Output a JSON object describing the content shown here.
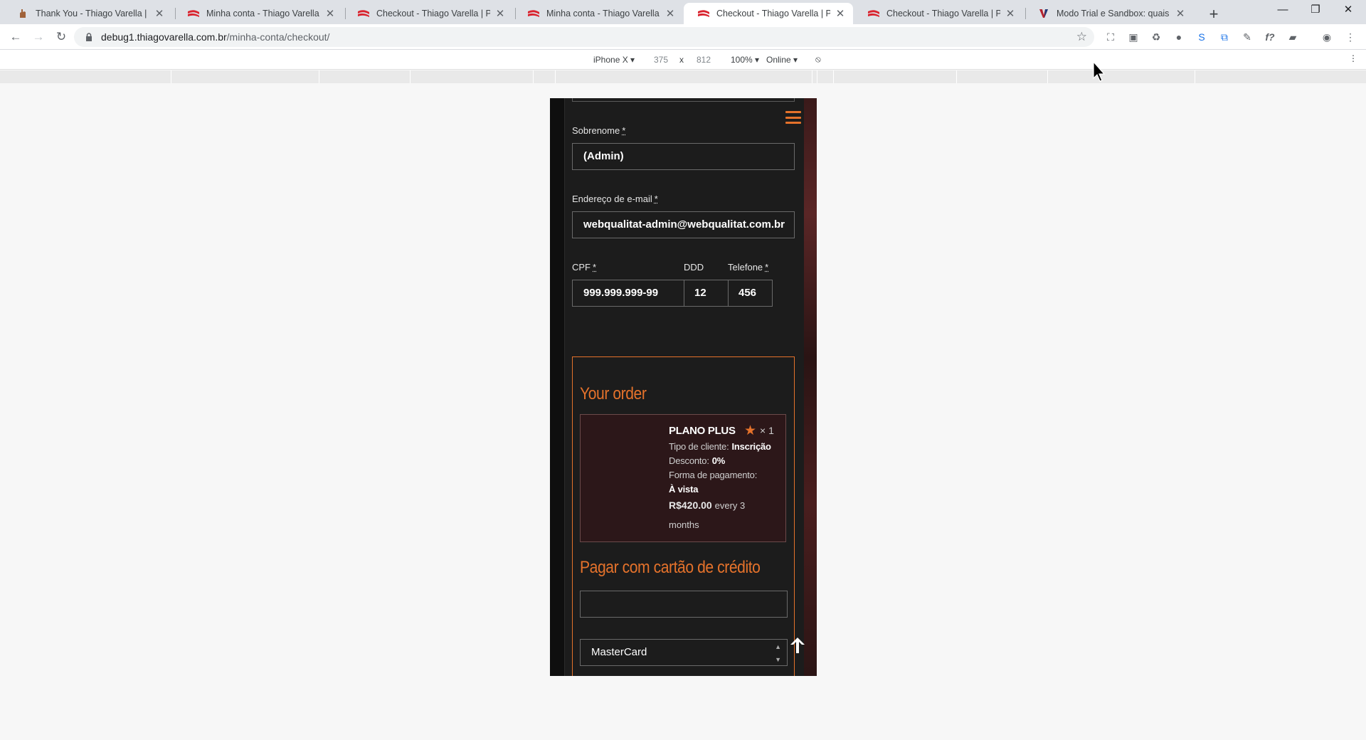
{
  "browser": {
    "tabs": [
      {
        "title": "Thank You - Thiago Varella | Prog",
        "favicon": "hand-icon",
        "active": false
      },
      {
        "title": "Minha conta - Thiago Varella | Pr",
        "favicon": "red-flag-icon",
        "active": false
      },
      {
        "title": "Checkout - Thiago Varella | Prog",
        "favicon": "red-flag-icon",
        "active": false
      },
      {
        "title": "Minha conta - Thiago Varella | Pr",
        "favicon": "red-flag-icon",
        "active": false
      },
      {
        "title": "Checkout - Thiago Varella | Prog",
        "favicon": "red-flag-icon",
        "active": true
      },
      {
        "title": "Checkout - Thiago Varella | Prog",
        "favicon": "red-flag-icon",
        "active": false
      },
      {
        "title": "Modo Trial e Sandbox: quais núm",
        "favicon": "v-logo-icon",
        "active": false
      }
    ],
    "url_host": "debug1.thiagovarella.com.br",
    "url_path": "/minha-conta/checkout/"
  },
  "device_toolbar": {
    "device": "iPhone X ▾",
    "width": "375",
    "times": "x",
    "height": "812",
    "zoom": "100% ▾",
    "network": "Online ▾"
  },
  "form": {
    "sobrenome_label": "Sobrenome",
    "sobrenome_value": "(Admin)",
    "email_label": "Endereço de e-mail",
    "email_value": "webqualitat-admin@webqualitat.com.br",
    "cpf_label": "CPF",
    "cpf_value": "999.999.999-99",
    "ddd_label": "DDD",
    "ddd_value": "12",
    "telefone_label": "Telefone",
    "telefone_value": "456",
    "required_mark": "*"
  },
  "order": {
    "title": "Your order",
    "product_name": "PLANO PLUS",
    "quantity": "× 1",
    "tipo_label": "Tipo de cliente:",
    "tipo_value": "Inscrição",
    "desconto_label": "Desconto:",
    "desconto_value": "0%",
    "forma_label": "Forma de pagamento:",
    "forma_value": "À vista",
    "price": "R$420.00",
    "period_a": "every 3",
    "period_b": "months"
  },
  "payment": {
    "title": "Pagar com cartão de crédito",
    "card_brand": "MasterCard"
  },
  "colors": {
    "accent": "#e5722b",
    "page_bg": "#1c1c1c"
  }
}
